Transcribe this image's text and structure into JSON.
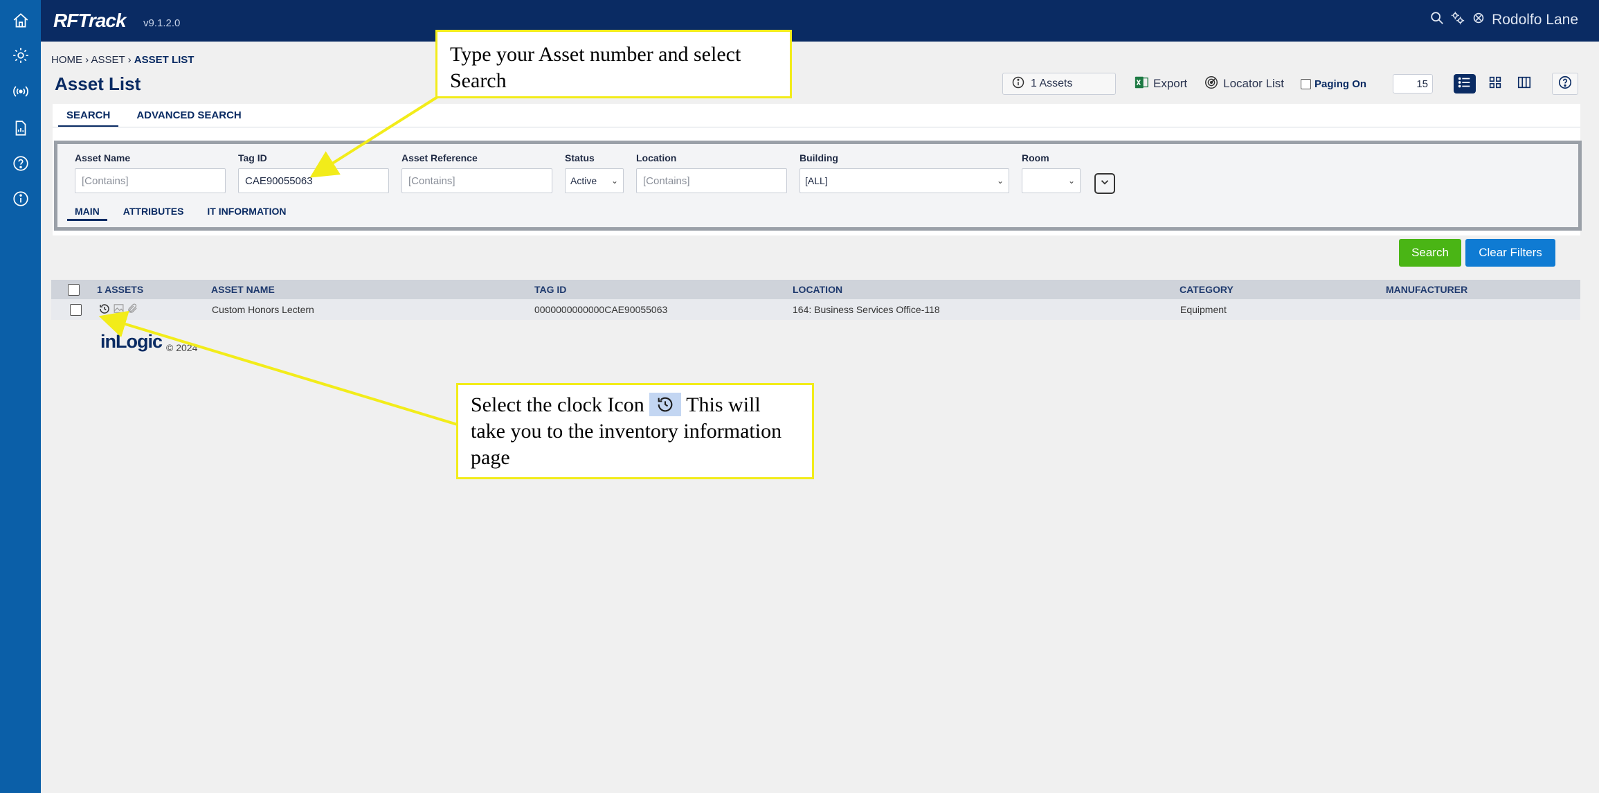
{
  "app": {
    "brand": "RFTrack",
    "version": "v9.1.2.0",
    "user_name": "Rodolfo Lane"
  },
  "left_nav": [
    "home-icon",
    "gear-icon",
    "radio-signal-icon",
    "report-file-icon",
    "help-circle-icon",
    "info-circle-icon"
  ],
  "breadcrumb": {
    "home": "HOME",
    "sep": "›",
    "asset": "ASSET",
    "current": "ASSET LIST"
  },
  "page_title": "Asset List",
  "toolbar": {
    "count_label": "1 Assets",
    "export_label": "Export",
    "locator_label": "Locator List",
    "paging_label": "Paging On",
    "page_size": "15"
  },
  "search_tabs": [
    "SEARCH",
    "ADVANCED SEARCH"
  ],
  "filters": {
    "asset_name": {
      "label": "Asset Name",
      "placeholder": "[Contains]",
      "value": ""
    },
    "tag_id": {
      "label": "Tag ID",
      "value": "CAE90055063"
    },
    "asset_reference": {
      "label": "Asset Reference",
      "placeholder": "[Contains]",
      "value": ""
    },
    "status": {
      "label": "Status",
      "value": "Active"
    },
    "location": {
      "label": "Location",
      "placeholder": "[Contains]",
      "value": ""
    },
    "building": {
      "label": "Building",
      "value": "[ALL]"
    },
    "room": {
      "label": "Room",
      "value": ""
    }
  },
  "sub_tabs": [
    "MAIN",
    "ATTRIBUTES",
    "IT INFORMATION"
  ],
  "buttons": {
    "search": "Search",
    "clear": "Clear Filters"
  },
  "table": {
    "columns": [
      "1 ASSETS",
      "ASSET NAME",
      "TAG ID",
      "LOCATION",
      "CATEGORY",
      "MANUFACTURER"
    ],
    "rows": [
      {
        "asset_name": "Custom Honors Lectern",
        "tag_id": "0000000000000CAE90055063",
        "location": "164: Business Services Office-118",
        "category": "Equipment",
        "manufacturer": ""
      }
    ]
  },
  "footer": {
    "logo": "inLogic",
    "copyright": "© 2024"
  },
  "annotations": {
    "type_asset": "Type your  Asset number and select Search",
    "clock_part1": "Select the clock Icon",
    "clock_part2": "This  will take you to the inventory information page"
  },
  "colors": {
    "nav": "#0b5fa8",
    "topbar": "#0a2b63",
    "search": "#4ab515",
    "clear": "#0f7bd3",
    "annotation": "#f2ec1a"
  }
}
